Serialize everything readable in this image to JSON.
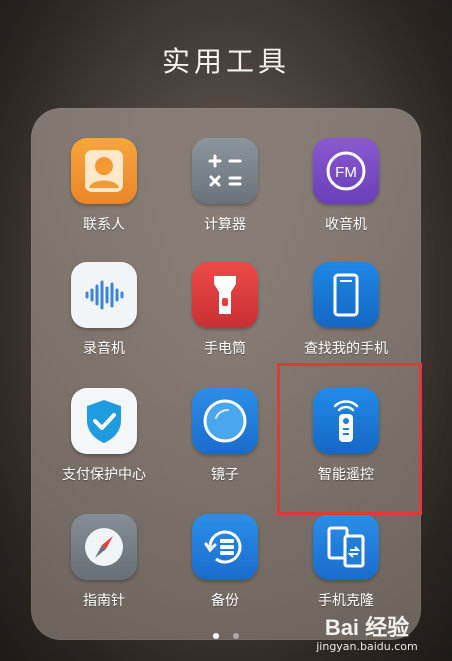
{
  "folder": {
    "title": "实用工具",
    "apps": [
      {
        "label": "联系人",
        "icon": "contacts-icon"
      },
      {
        "label": "计算器",
        "icon": "calculator-icon"
      },
      {
        "label": "收音机",
        "icon": "fm-radio-icon",
        "badge": "FM"
      },
      {
        "label": "录音机",
        "icon": "voice-recorder-icon"
      },
      {
        "label": "手电筒",
        "icon": "flashlight-icon"
      },
      {
        "label": "查找我的手机",
        "icon": "find-phone-icon"
      },
      {
        "label": "支付保护中心",
        "icon": "payment-shield-icon"
      },
      {
        "label": "镜子",
        "icon": "mirror-icon"
      },
      {
        "label": "智能遥控",
        "icon": "smart-remote-icon"
      },
      {
        "label": "指南针",
        "icon": "compass-icon"
      },
      {
        "label": "备份",
        "icon": "backup-icon"
      },
      {
        "label": "手机克隆",
        "icon": "phone-clone-icon"
      }
    ],
    "pages": {
      "count": 2,
      "active": 1
    }
  },
  "highlight": {
    "target": "智能遥控",
    "color": "#e03a38"
  },
  "watermark": {
    "logo": "Bai 经验",
    "url": "jingyan.baidu.com"
  },
  "colors": {
    "accent_blue": "#1f87e6",
    "contacts_orange": "#f39a35",
    "torch_red": "#e33e40",
    "fm_purple": "#7b4bc6"
  }
}
